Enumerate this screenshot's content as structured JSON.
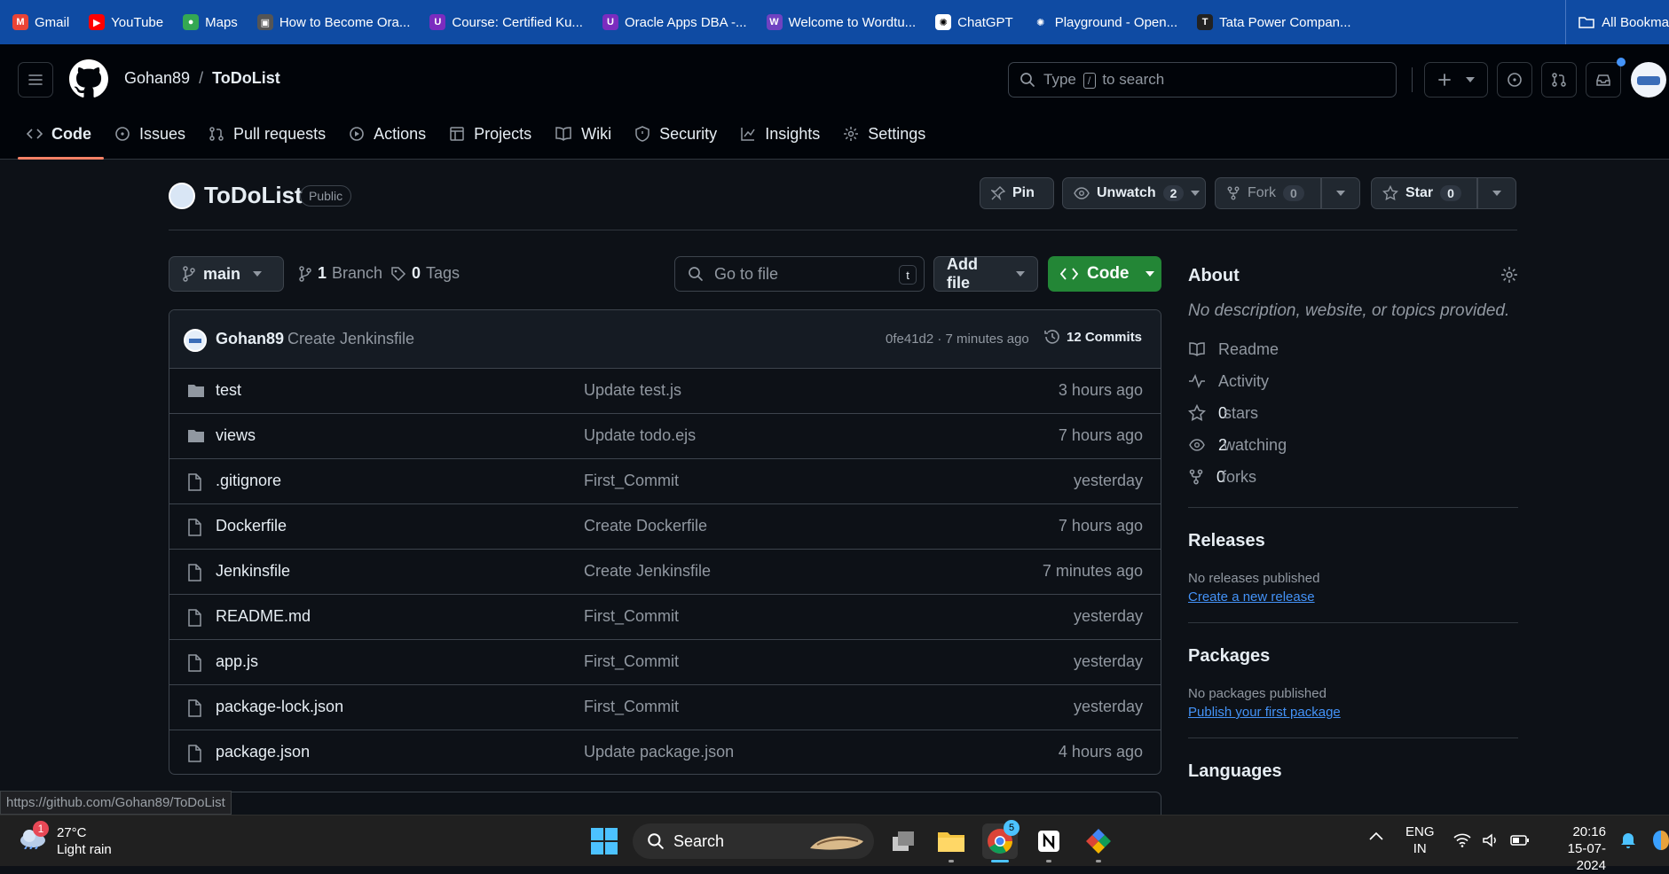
{
  "bookmarks": {
    "items": [
      {
        "label": "Gmail",
        "color": "#ea4335",
        "glyph": "M"
      },
      {
        "label": "YouTube",
        "color": "#ff0000",
        "glyph": "▶"
      },
      {
        "label": "Maps",
        "color": "#34a853",
        "glyph": "●"
      },
      {
        "label": "How to Become Ora...",
        "color": "#555555",
        "glyph": "▣"
      },
      {
        "label": "Course: Certified Ku...",
        "color": "#7b2cbf",
        "glyph": "U"
      },
      {
        "label": "Oracle Apps DBA -...",
        "color": "#7b2cbf",
        "glyph": "U"
      },
      {
        "label": "Welcome to Wordtu...",
        "color": "#6f42c1",
        "glyph": "W"
      },
      {
        "label": "ChatGPT",
        "color": "#ffffff",
        "glyph": "✺"
      },
      {
        "label": "Playground - Open...",
        "color": "#0f4ba3",
        "glyph": "✺"
      },
      {
        "label": "Tata Power Compan...",
        "color": "#222222",
        "glyph": "T"
      }
    ],
    "all_label": "All Bookma"
  },
  "header": {
    "owner": "Gohan89",
    "separator": "/",
    "repo": "ToDoList",
    "search_prefix": "Type",
    "search_key": "/",
    "search_suffix": "to search"
  },
  "nav": {
    "tabs": [
      {
        "label": "Code",
        "icon": "code-icon"
      },
      {
        "label": "Issues",
        "icon": "issue-icon"
      },
      {
        "label": "Pull requests",
        "icon": "pull-request-icon"
      },
      {
        "label": "Actions",
        "icon": "play-icon"
      },
      {
        "label": "Projects",
        "icon": "table-icon"
      },
      {
        "label": "Wiki",
        "icon": "book-icon"
      },
      {
        "label": "Security",
        "icon": "shield-icon"
      },
      {
        "label": "Insights",
        "icon": "graph-icon"
      },
      {
        "label": "Settings",
        "icon": "gear-icon"
      }
    ]
  },
  "repo": {
    "name": "ToDoList",
    "visibility": "Public",
    "pin_label": "Pin",
    "unwatch_label": "Unwatch",
    "watch_count": "2",
    "fork_label": "Fork",
    "fork_count": "0",
    "star_label": "Star",
    "star_count": "0"
  },
  "toolbar": {
    "branch": "main",
    "branch_count": "1",
    "branch_label": "Branch",
    "tag_count": "0",
    "tag_label": "Tags",
    "goto_placeholder": "Go to file",
    "goto_key": "t",
    "add_file_label": "Add file",
    "code_label": "Code"
  },
  "commit": {
    "author": "Gohan89",
    "message": "Create Jenkinsfile",
    "meta": "0fe41d2 · 7 minutes ago",
    "commits_label": "12 Commits"
  },
  "files": [
    {
      "name": "test",
      "type": "dir",
      "message": "Update test.js",
      "time": "3 hours ago"
    },
    {
      "name": "views",
      "type": "dir",
      "message": "Update todo.ejs",
      "time": "7 hours ago"
    },
    {
      "name": ".gitignore",
      "type": "file",
      "message": "First_Commit",
      "time": "yesterday"
    },
    {
      "name": "Dockerfile",
      "type": "file",
      "message": "Create Dockerfile",
      "time": "7 hours ago"
    },
    {
      "name": "Jenkinsfile",
      "type": "file",
      "message": "Create Jenkinsfile",
      "time": "7 minutes ago"
    },
    {
      "name": "README.md",
      "type": "file",
      "message": "First_Commit",
      "time": "yesterday"
    },
    {
      "name": "app.js",
      "type": "file",
      "message": "First_Commit",
      "time": "yesterday"
    },
    {
      "name": "package-lock.json",
      "type": "file",
      "message": "First_Commit",
      "time": "yesterday"
    },
    {
      "name": "package.json",
      "type": "file",
      "message": "Update package.json",
      "time": "4 hours ago"
    }
  ],
  "about": {
    "title": "About",
    "description": "No description, website, or topics provided.",
    "readme": "Readme",
    "activity": "Activity",
    "stars_count": "0",
    "stars_label": "stars",
    "watching_count": "2",
    "watching_label": "watching",
    "forks_count": "0",
    "forks_label": "forks"
  },
  "releases": {
    "title": "Releases",
    "empty": "No releases published",
    "link": "Create a new release"
  },
  "packages": {
    "title": "Packages",
    "empty": "No packages published",
    "link": "Publish your first package"
  },
  "languages": {
    "title": "Languages"
  },
  "status_url": "https://github.com/Gohan89/ToDoList",
  "taskbar": {
    "weather_temp": "27°C",
    "weather_desc": "Light rain",
    "weather_badge": "1",
    "search_label": "Search",
    "chrome_badge": "5",
    "lang_top": "ENG",
    "lang_bottom": "IN",
    "time": "20:16",
    "date": "15-07-2024"
  },
  "colors": {
    "accent_green": "#238636",
    "link_blue": "#4493f8",
    "tab_underline": "#f78166",
    "bookmarks_bar": "#0f4ba3"
  }
}
